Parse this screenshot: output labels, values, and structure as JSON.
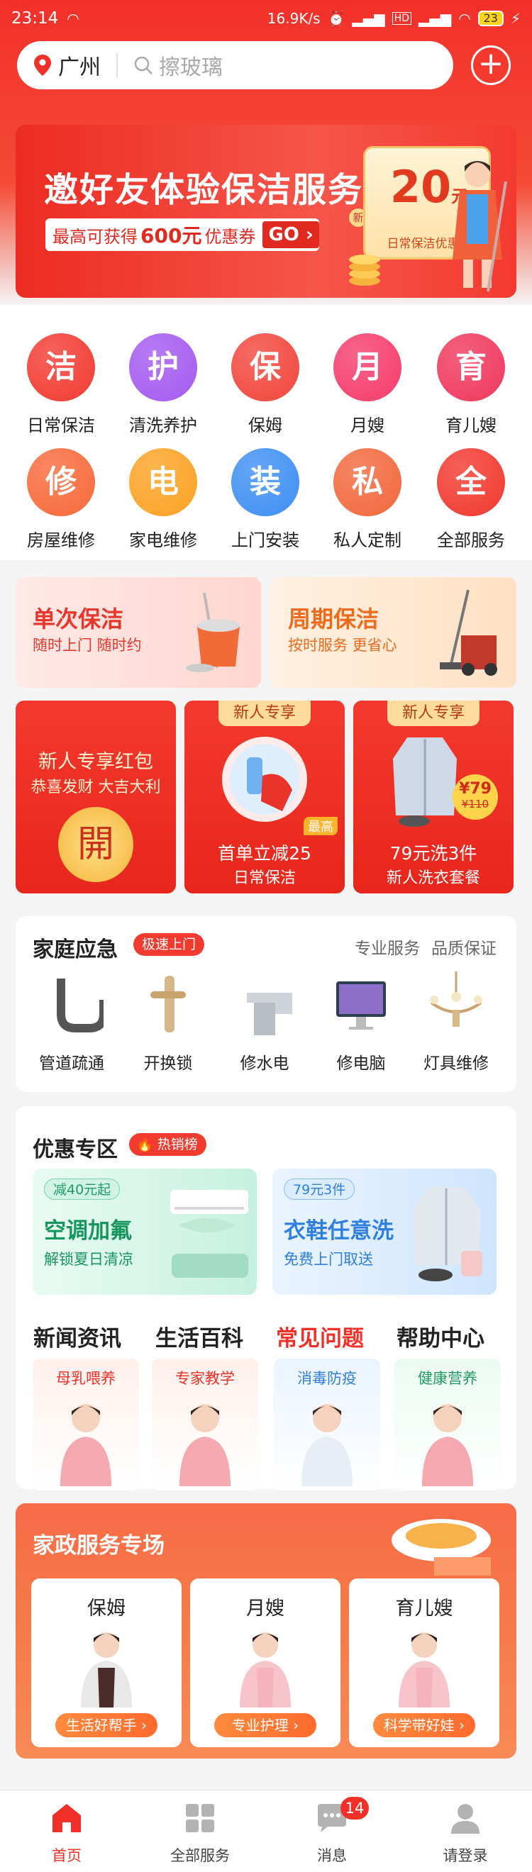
{
  "status_bar": {
    "time": "23:14",
    "net_speed": "16.9K/s",
    "battery": "23"
  },
  "search": {
    "city": "广州",
    "placeholder": "擦玻璃"
  },
  "banner": {
    "title": "邀好友体验保洁服务",
    "sub_prefix": "最高可获得",
    "sub_amount": "600元",
    "sub_suffix": "优惠券",
    "go": "GO",
    "coupon_amount": "20",
    "coupon_unit": "元",
    "coupon_label": "日常保洁优惠券",
    "coupon_small": "新"
  },
  "categories": [
    {
      "glyph": "洁",
      "label": "日常保洁",
      "color": "#f23b32"
    },
    {
      "glyph": "护",
      "label": "清洗养护",
      "color": "#a45af0"
    },
    {
      "glyph": "保",
      "label": "保姆",
      "color": "#f2463c"
    },
    {
      "glyph": "月",
      "label": "月嫂",
      "color": "#f53c6c"
    },
    {
      "glyph": "育",
      "label": "育儿嫂",
      "color": "#f0385c"
    },
    {
      "glyph": "修",
      "label": "房屋维修",
      "color": "#f8693a"
    },
    {
      "glyph": "电",
      "label": "家电维修",
      "color": "#fba223"
    },
    {
      "glyph": "装",
      "label": "上门安装",
      "color": "#3e8ff3"
    },
    {
      "glyph": "私",
      "label": "私人定制",
      "color": "#f2683c"
    },
    {
      "glyph": "全",
      "label": "全部服务",
      "color": "#f2382e"
    }
  ],
  "cleaning": [
    {
      "title": "单次保洁",
      "sub": "随时上门 随时约"
    },
    {
      "title": "周期保洁",
      "sub": "按时服务 更省心"
    }
  ],
  "promos": [
    {
      "title": "新人专享红包",
      "sub": "恭喜发财 大吉大利",
      "seal": "開"
    },
    {
      "tag": "新人专享",
      "main": "首单立减25",
      "corner": "最高",
      "sub": "日常保洁"
    },
    {
      "tag": "新人专享",
      "price": "¥79",
      "old_price": "¥110",
      "main": "79元洗3件",
      "sub": "新人洗衣套餐"
    }
  ],
  "emergency": {
    "title": "家庭应急",
    "badge": "极速上门",
    "right1": "专业服务",
    "right2": "品质保证",
    "items": [
      {
        "label": "管道疏通",
        "icon": "pipe-icon"
      },
      {
        "label": "开换锁",
        "icon": "door-handle-icon"
      },
      {
        "label": "修水电",
        "icon": "faucet-icon"
      },
      {
        "label": "修电脑",
        "icon": "computer-icon"
      },
      {
        "label": "灯具维修",
        "icon": "chandelier-icon"
      }
    ]
  },
  "discount": {
    "title": "优惠专区",
    "badge": "热销榜",
    "cards": [
      {
        "pill": "减40元起",
        "title": "空调加氟",
        "sub": "解锁夏日清凉"
      },
      {
        "pill": "79元3件",
        "title": "衣鞋任意洗",
        "sub": "免费上门取送"
      }
    ]
  },
  "info": {
    "tabs": [
      "新闻资讯",
      "生活百科",
      "常见问题",
      "帮助中心"
    ],
    "cards": [
      "母乳喂养",
      "专家教学",
      "消毒防疫",
      "健康营养"
    ]
  },
  "housekeeping": {
    "title": "家政服务专场",
    "cards": [
      {
        "name": "保姆",
        "btn": "生活好帮手"
      },
      {
        "name": "月嫂",
        "btn": "专业护理"
      },
      {
        "name": "育儿嫂",
        "btn": "科学带好娃"
      }
    ]
  },
  "nav": {
    "items": [
      {
        "label": "首页",
        "icon": "home-icon"
      },
      {
        "label": "全部服务",
        "icon": "grid-icon"
      },
      {
        "label": "消息",
        "icon": "message-icon"
      },
      {
        "label": "请登录",
        "icon": "user-icon"
      }
    ],
    "badge": "14",
    "active_color": "#f2302a"
  }
}
